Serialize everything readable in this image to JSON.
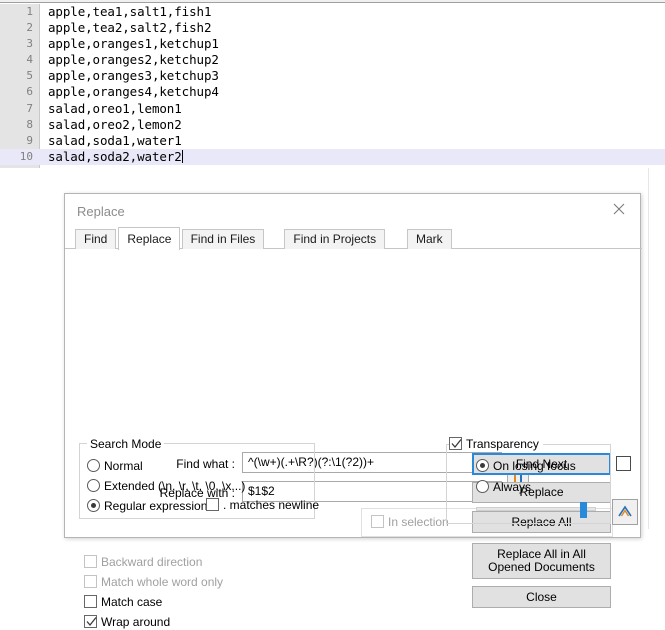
{
  "editor": {
    "lines": [
      {
        "num": "1",
        "text": "apple,tea1,salt1,fish1"
      },
      {
        "num": "2",
        "text": "apple,tea2,salt2,fish2"
      },
      {
        "num": "3",
        "text": "apple,oranges1,ketchup1"
      },
      {
        "num": "4",
        "text": "apple,oranges2,ketchup2"
      },
      {
        "num": "5",
        "text": "apple,oranges3,ketchup3"
      },
      {
        "num": "6",
        "text": "apple,oranges4,ketchup4"
      },
      {
        "num": "7",
        "text": "salad,oreo1,lemon1"
      },
      {
        "num": "8",
        "text": "salad,oreo2,lemon2"
      },
      {
        "num": "9",
        "text": "salad,soda1,water1"
      },
      {
        "num": "10",
        "text": "salad,soda2,water2"
      }
    ],
    "current_line_index": 9,
    "current_line_bg": "#e8e8f8",
    "gutter_bg": "#e4e4e4"
  },
  "dialog": {
    "title": "Replace",
    "close_icon": "close-icon",
    "tabs": [
      {
        "label": "Find",
        "active": false
      },
      {
        "label": "Replace",
        "active": true
      },
      {
        "label": "Find in Files",
        "active": false
      },
      {
        "label": "Find in Projects",
        "active": false
      },
      {
        "label": "Mark",
        "active": false
      }
    ],
    "fields": {
      "find_label": "Find what :",
      "find_value": "^(\\w+)(.+\\R?)(?:\\1(?2))+",
      "replace_label": "Replace with :",
      "replace_value": "$1$2",
      "swap_icon": "swap-arrows-icon"
    },
    "buttons": {
      "find_next": "Find Next",
      "replace": "Replace",
      "replace_all": "Replace All",
      "replace_all_opened": "Replace All in All Opened Documents",
      "close": "Close"
    },
    "options": {
      "find_next_extra_checkbox": {
        "label": "",
        "checked": false
      },
      "in_selection": {
        "label": "In selection",
        "checked": false,
        "enabled": false
      },
      "backward_direction": {
        "label": "Backward direction",
        "checked": false,
        "enabled": false
      },
      "match_whole_word_only": {
        "label": "Match whole word only",
        "checked": false,
        "enabled": false
      },
      "match_case": {
        "label": "Match case",
        "checked": false,
        "enabled": true
      },
      "wrap_around": {
        "label": "Wrap around",
        "checked": true,
        "enabled": true
      }
    },
    "search_mode": {
      "title": "Search Mode",
      "options": [
        {
          "label": "Normal",
          "selected": false
        },
        {
          "label": "Extended (\\n, \\r, \\t, \\0, \\x...)",
          "selected": false
        },
        {
          "label": "Regular expression",
          "selected": true
        }
      ],
      "dot_matches_newline": {
        "label": ". matches newline",
        "checked": false
      }
    },
    "transparency": {
      "label": "Transparency",
      "checked": true,
      "options": [
        {
          "label": "On losing focus",
          "selected": true
        },
        {
          "label": "Always",
          "selected": false
        }
      ],
      "slider_value_pct": 88
    }
  },
  "statusbar": {
    "caret_button_icon": "chevron-up-icon"
  },
  "colors": {
    "accent": "#2a8ada",
    "button_face": "#e1e1e1",
    "dialog_bg": "#ffffff",
    "disabled_text": "#a0a0a0"
  }
}
